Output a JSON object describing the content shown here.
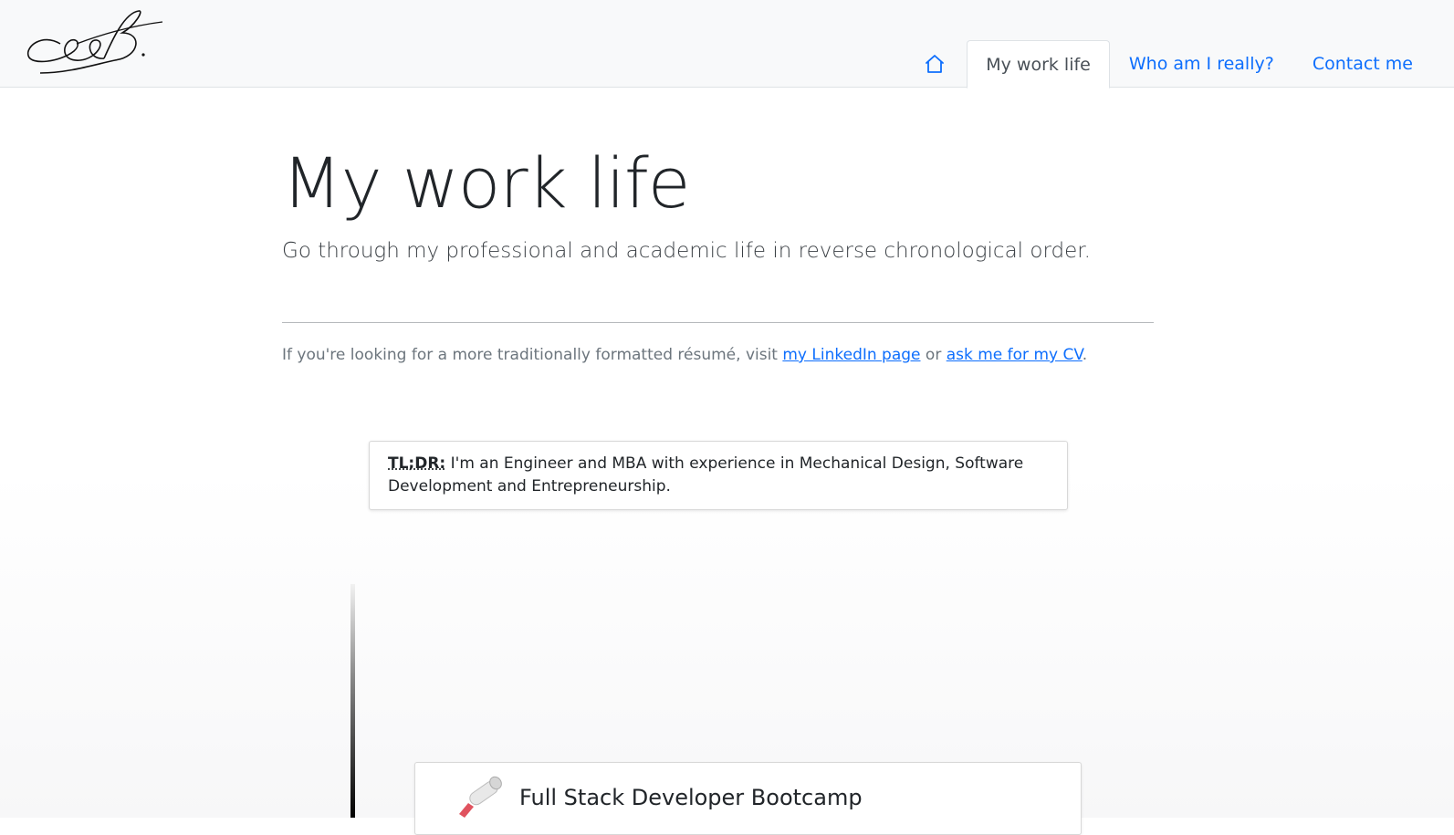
{
  "header": {
    "logo_text": "G.B.",
    "nav": [
      {
        "label": "",
        "icon": "home-icon"
      },
      {
        "label": "My work life",
        "active": true
      },
      {
        "label": "Who am I really?"
      },
      {
        "label": "Contact me"
      }
    ]
  },
  "hero": {
    "title": "My work life",
    "subtitle": "Go through my professional and academic life in reverse chronological order."
  },
  "intro": {
    "prefix": "If you're looking for a more traditionally formatted résumé, visit ",
    "linkedin_label": "my LinkedIn page",
    "middle": " or ",
    "cv_label": "ask me for my CV",
    "suffix": "."
  },
  "tldr": {
    "label": "TL;DR:",
    "text": " I'm an Engineer and MBA with experience in Mechanical Design, Software Development and Entrepreneurship."
  },
  "timeline": {
    "entries": [
      {
        "title": "Full Stack Developer Bootcamp",
        "icon": "diploma-icon"
      }
    ]
  },
  "colors": {
    "link": "#0d6efd",
    "header_bg": "#f8f9fa"
  }
}
